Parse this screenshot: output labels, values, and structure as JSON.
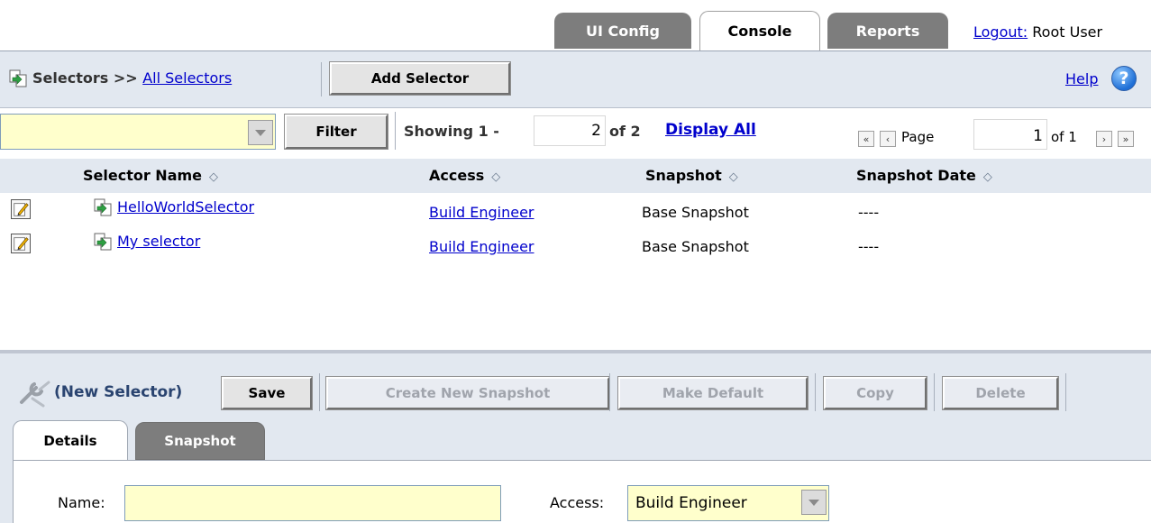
{
  "top_tabs": [
    {
      "label": "UI Config",
      "active": false
    },
    {
      "label": "Console",
      "active": true
    },
    {
      "label": "Reports",
      "active": false
    }
  ],
  "logout": {
    "link": "Logout:",
    "user": "Root User"
  },
  "header": {
    "breadcrumb_prefix": "Selectors >> ",
    "breadcrumb_link": "All Selectors",
    "add_button": "Add Selector",
    "help": "Help"
  },
  "filter": {
    "value": "",
    "button": "Filter",
    "showing_label": "Showing 1 -",
    "showing_to": "2",
    "showing_of": "of 2",
    "display_all": "Display All",
    "page_label": "Page",
    "page_value": "1",
    "page_of": "of 1"
  },
  "table": {
    "columns": [
      "Selector Name",
      "Access",
      "Snapshot",
      "Snapshot Date"
    ],
    "rows": [
      {
        "name": "HelloWorldSelector",
        "access": "Build Engineer",
        "snapshot": "Base Snapshot",
        "date": "----"
      },
      {
        "name": "My selector",
        "access": "Build Engineer",
        "snapshot": "Base Snapshot",
        "date": "----"
      }
    ]
  },
  "editor": {
    "title": "(New Selector)",
    "buttons": {
      "save": "Save",
      "create_snapshot": "Create New Snapshot",
      "make_default": "Make Default",
      "copy": "Copy",
      "delete": "Delete"
    },
    "tabs": [
      {
        "label": "Details",
        "active": true
      },
      {
        "label": "Snapshot",
        "active": false
      }
    ],
    "name_label": "Name:",
    "name_value": "",
    "access_label": "Access:",
    "access_value": "Build Engineer"
  },
  "colors": {
    "accent_link": "#0000cc",
    "field_bg": "#ffffcc",
    "panel_bg": "#e2e8f0",
    "inactive_tab": "#7d7d7d"
  }
}
